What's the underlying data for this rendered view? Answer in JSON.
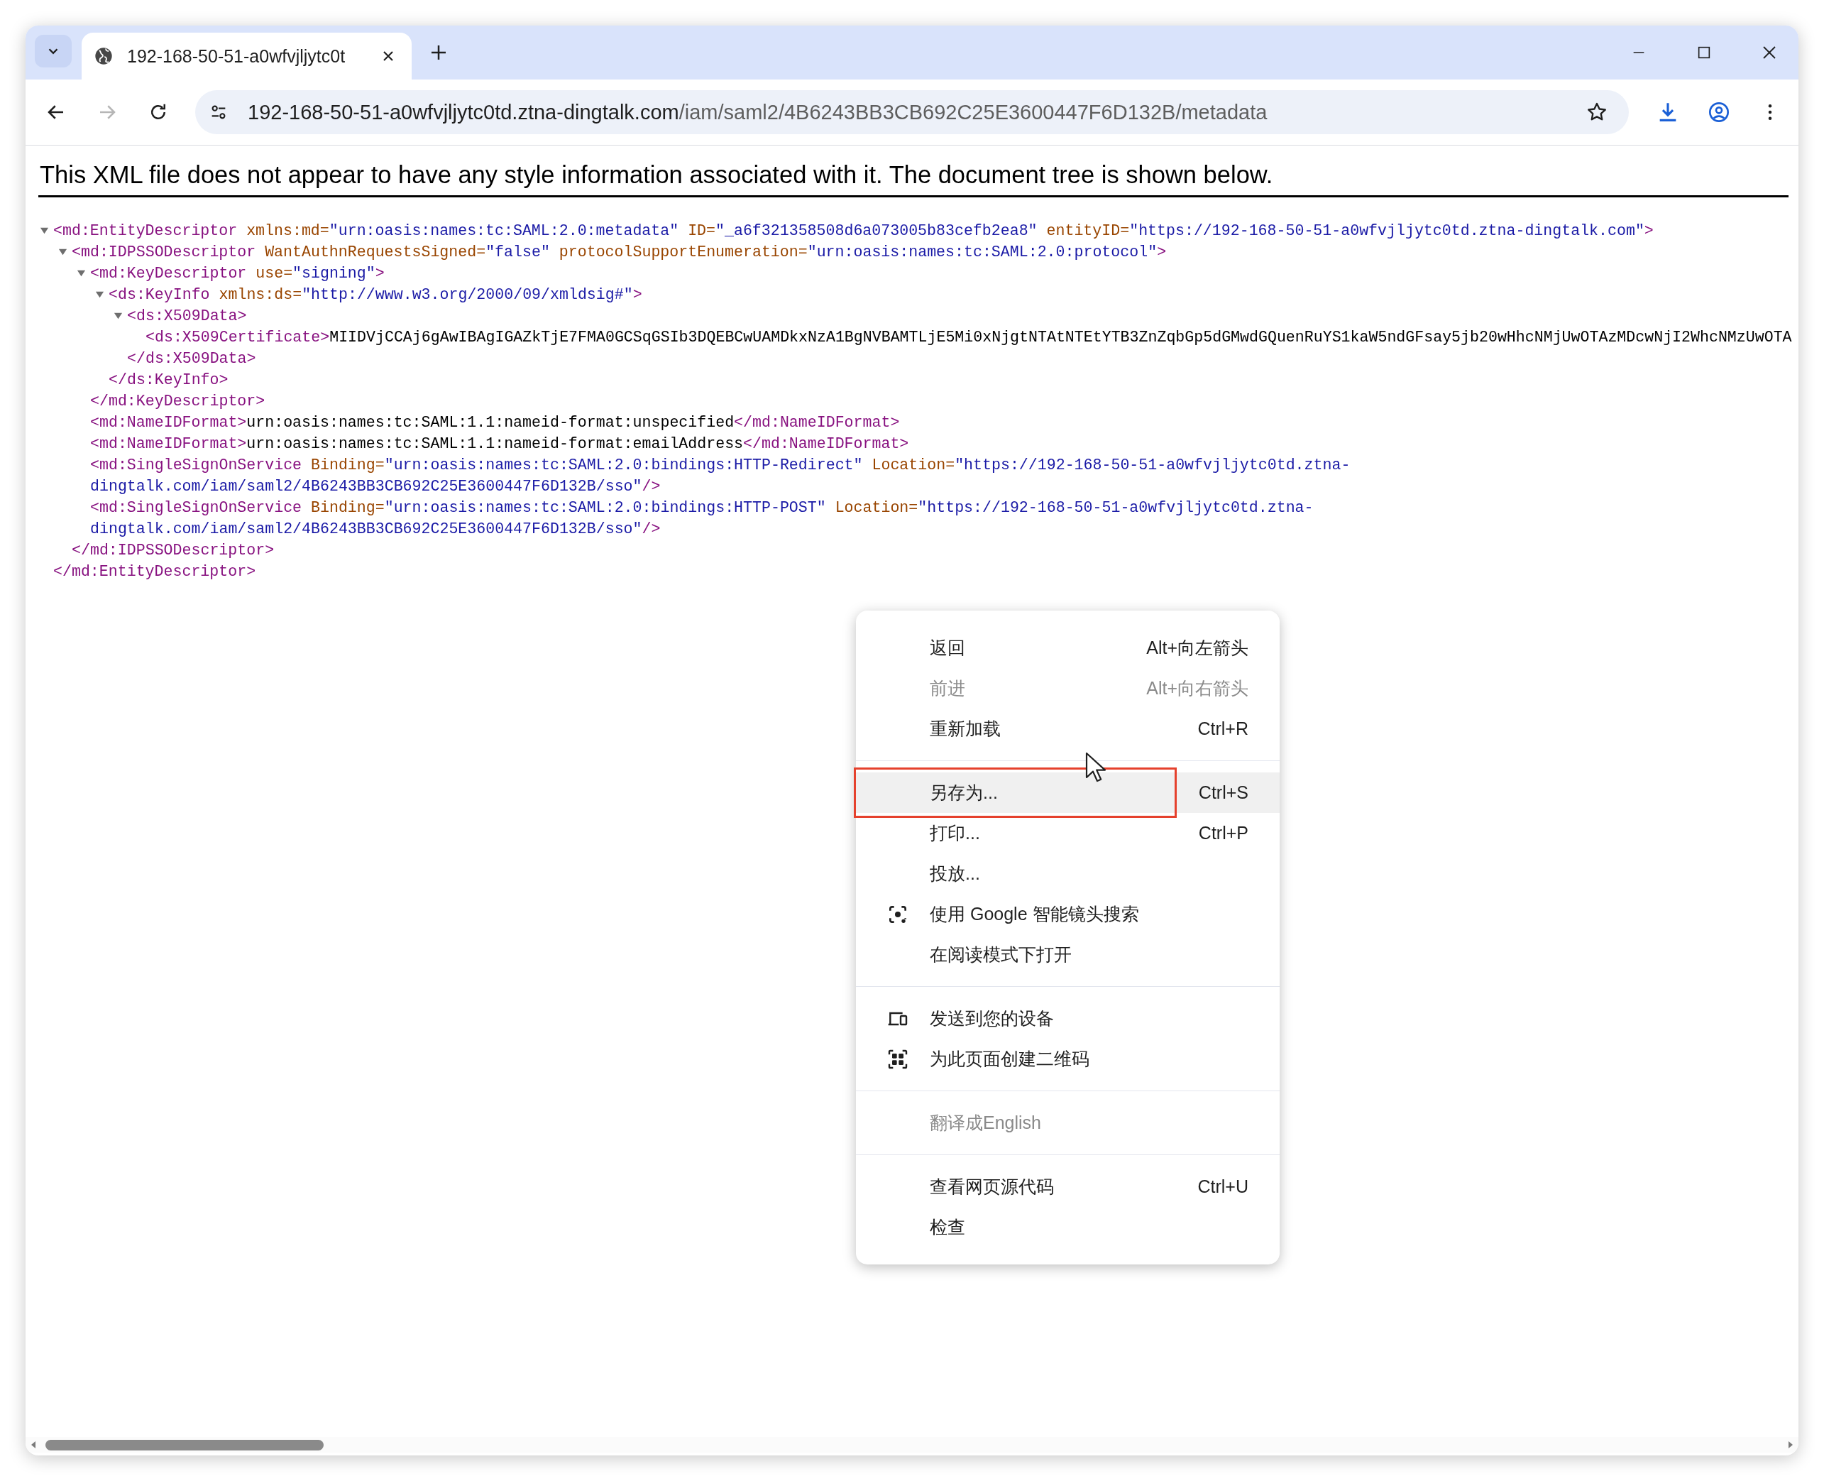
{
  "window": {
    "tabs": [
      {
        "title": "192-168-50-51-a0wfvjljytc0t",
        "selected": true
      }
    ],
    "toolbar": {
      "back": {
        "disabled": false
      },
      "forward": {
        "disabled": true
      }
    },
    "address_bar": {
      "host": "192-168-50-51-a0wfvjljytc0td.ztna-dingtalk.com",
      "path": "/iam/saml2/4B6243BB3CB692C25E3600447F6D132B/metadata"
    }
  },
  "page": {
    "notice": "This XML file does not appear to have any style information associated with it. The document tree is shown below.",
    "xml_tree": {
      "expanded": true,
      "open": [
        {
          "kind": "tag",
          "text": "<md:EntityDescriptor"
        },
        {
          "kind": "attr",
          "text": " xmlns:md="
        },
        {
          "kind": "value",
          "text": "\"urn:oasis:names:tc:SAML:2.0:metadata\""
        },
        {
          "kind": "attr",
          "text": " ID="
        },
        {
          "kind": "value",
          "text": "\"_a6f321358508d6a073005b83cefb2ea8\""
        },
        {
          "kind": "attr",
          "text": " entityID="
        },
        {
          "kind": "value",
          "text": "\"https://192-168-50-51-a0wfvjljytc0td.ztna-dingtalk.com\""
        },
        {
          "kind": "tag",
          "text": ">"
        }
      ],
      "children": [
        {
          "expanded": true,
          "open": [
            {
              "kind": "tag",
              "text": "<md:IDPSSODescriptor"
            },
            {
              "kind": "attr",
              "text": " WantAuthnRequestsSigned="
            },
            {
              "kind": "value",
              "text": "\"false\""
            },
            {
              "kind": "attr",
              "text": " protocolSupportEnumeration="
            },
            {
              "kind": "value",
              "text": "\"urn:oasis:names:tc:SAML:2.0:protocol\""
            },
            {
              "kind": "tag",
              "text": ">"
            }
          ],
          "children": [
            {
              "expanded": true,
              "open": [
                {
                  "kind": "tag",
                  "text": "<md:KeyDescriptor"
                },
                {
                  "kind": "attr",
                  "text": " use="
                },
                {
                  "kind": "value",
                  "text": "\"signing\""
                },
                {
                  "kind": "tag",
                  "text": ">"
                }
              ],
              "children": [
                {
                  "expanded": true,
                  "open": [
                    {
                      "kind": "tag",
                      "text": "<ds:KeyInfo"
                    },
                    {
                      "kind": "attr",
                      "text": " xmlns:ds="
                    },
                    {
                      "kind": "value",
                      "text": "\"http://www.w3.org/2000/09/xmldsig#\""
                    },
                    {
                      "kind": "tag",
                      "text": ">"
                    }
                  ],
                  "children": [
                    {
                      "expanded": true,
                      "open": [
                        {
                          "kind": "tag",
                          "text": "<ds:X509Data>"
                        }
                      ],
                      "children": [
                        {
                          "line": [
                            {
                              "kind": "tag",
                              "text": "<ds:X509Certificate>"
                            },
                            {
                              "kind": "text",
                              "text": "MIIDVjCCAj6gAwIBAgIGAZkTjE7FMA0GCSqGSIb3DQEBCwUAMDkxNzA1BgNVBAMTLjE5Mi0xNjgtNTAtNTEtYTB3ZnZqbGp5dGMwdGQuenRuYS1kaW5ndGFsay5jb20wHhcNMjUwOTAzMDcwNjI2WhcNMzUwOTA"
                            }
                          ]
                        }
                      ],
                      "close": [
                        {
                          "kind": "tag",
                          "text": "</ds:X509Data>"
                        }
                      ]
                    }
                  ],
                  "close": [
                    {
                      "kind": "tag",
                      "text": "</ds:KeyInfo>"
                    }
                  ]
                }
              ],
              "close": [
                {
                  "kind": "tag",
                  "text": "</md:KeyDescriptor>"
                }
              ]
            },
            {
              "line": [
                {
                  "kind": "tag",
                  "text": "<md:NameIDFormat>"
                },
                {
                  "kind": "text",
                  "text": "urn:oasis:names:tc:SAML:1.1:nameid-format:unspecified"
                },
                {
                  "kind": "tag",
                  "text": "</md:NameIDFormat>"
                }
              ]
            },
            {
              "line": [
                {
                  "kind": "tag",
                  "text": "<md:NameIDFormat>"
                },
                {
                  "kind": "text",
                  "text": "urn:oasis:names:tc:SAML:1.1:nameid-format:emailAddress"
                },
                {
                  "kind": "tag",
                  "text": "</md:NameIDFormat>"
                }
              ]
            },
            {
              "line": [
                {
                  "kind": "tag",
                  "text": "<md:SingleSignOnService"
                },
                {
                  "kind": "attr",
                  "text": " Binding="
                },
                {
                  "kind": "value",
                  "text": "\"urn:oasis:names:tc:SAML:2.0:bindings:HTTP-Redirect\""
                },
                {
                  "kind": "attr",
                  "text": " Location="
                },
                {
                  "kind": "value",
                  "text": "\"https://192-168-50-51-a0wfvjljytc0td.ztna-dingtalk.com/iam/saml2/4B6243BB3CB692C25E3600447F6D132B/sso\""
                },
                {
                  "kind": "tag",
                  "text": "/>"
                }
              ]
            },
            {
              "line": [
                {
                  "kind": "tag",
                  "text": "<md:SingleSignOnService"
                },
                {
                  "kind": "attr",
                  "text": " Binding="
                },
                {
                  "kind": "value",
                  "text": "\"urn:oasis:names:tc:SAML:2.0:bindings:HTTP-POST\""
                },
                {
                  "kind": "attr",
                  "text": " Location="
                },
                {
                  "kind": "value",
                  "text": "\"https://192-168-50-51-a0wfvjljytc0td.ztna-dingtalk.com/iam/saml2/4B6243BB3CB692C25E3600447F6D132B/sso\""
                },
                {
                  "kind": "tag",
                  "text": "/>"
                }
              ]
            }
          ],
          "close": [
            {
              "kind": "tag",
              "text": "</md:IDPSSODescriptor>"
            }
          ]
        }
      ],
      "close": [
        {
          "kind": "tag",
          "text": "</md:EntityDescriptor>"
        }
      ]
    }
  },
  "context_menu": {
    "sections": [
      [
        {
          "kind": "item",
          "label": "返回",
          "shortcut": "Alt+向左箭头",
          "disabled": false,
          "highlighted": false,
          "outlined": false
        },
        {
          "kind": "item",
          "label": "前进",
          "shortcut": "Alt+向右箭头",
          "disabled": true,
          "highlighted": false,
          "outlined": false
        },
        {
          "kind": "item",
          "label": "重新加载",
          "shortcut": "Ctrl+R",
          "disabled": false,
          "highlighted": false,
          "outlined": false
        }
      ],
      [
        {
          "kind": "item",
          "label": "另存为...",
          "shortcut": "Ctrl+S",
          "disabled": false,
          "highlighted": true,
          "outlined": true
        },
        {
          "kind": "item",
          "label": "打印...",
          "shortcut": "Ctrl+P",
          "disabled": false,
          "highlighted": false,
          "outlined": false
        },
        {
          "kind": "item",
          "label": "投放...",
          "disabled": false,
          "highlighted": false,
          "outlined": false
        },
        {
          "kind": "lens",
          "label": "使用 Google 智能镜头搜索",
          "disabled": false,
          "highlighted": false,
          "outlined": false
        },
        {
          "kind": "item",
          "label": "在阅读模式下打开",
          "disabled": false,
          "highlighted": false,
          "outlined": false
        }
      ],
      [
        {
          "kind": "devices",
          "label": "发送到您的设备",
          "disabled": false,
          "highlighted": false,
          "outlined": false
        },
        {
          "kind": "qr",
          "label": "为此页面创建二维码",
          "disabled": false,
          "highlighted": false,
          "outlined": false
        }
      ],
      [
        {
          "kind": "item",
          "label": "翻译成English",
          "disabled": true,
          "highlighted": false,
          "outlined": false
        }
      ],
      [
        {
          "kind": "item",
          "label": "查看网页源代码",
          "shortcut": "Ctrl+U",
          "disabled": false,
          "highlighted": false,
          "outlined": false
        },
        {
          "kind": "item",
          "label": "检查",
          "disabled": false,
          "highlighted": false,
          "outlined": false
        }
      ]
    ]
  }
}
